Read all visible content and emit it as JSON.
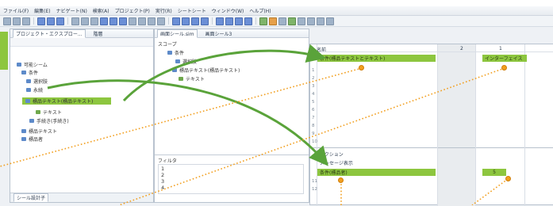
{
  "menubar": {
    "items": [
      "ファイル(F)",
      "編集(E)",
      "ナビゲート(N)",
      "検索(A)",
      "プロジェクト(P)",
      "実行(R)",
      "シートシート",
      "ウィンドウ(W)",
      "ヘルプ(H)"
    ]
  },
  "left_panel": {
    "tabs": [
      "プロジェクト・エクスプロー...",
      "階層"
    ],
    "tree": [
      "可能シーム",
      "条件",
      "選択肢",
      "永続",
      "標品テキスト(標品テキスト)",
      "テキスト",
      "手続き(手続き)",
      "標品テキスト",
      "標品者"
    ],
    "highlighted": "標品テキスト(標品テキスト)",
    "bottom_tab": "シール設計子"
  },
  "middle_panel": {
    "tabs": [
      "画面シール.sim",
      "画面シール3"
    ],
    "scope_label": "スコープ",
    "tree": [
      "条件",
      "選択肢",
      "標品テキスト(標品テキスト)",
      "テキスト"
    ],
    "filter_label": "フィルタ",
    "filter_rows": [
      "1",
      "2",
      "3",
      "4"
    ]
  },
  "right_panel": {
    "header": [
      "名前",
      "2",
      "1"
    ],
    "top_green_left": "条件(標品テキストとテキスト)",
    "top_green_right": "インターフェイス",
    "row_numbers": [
      "1",
      "2",
      "3",
      "4",
      "5",
      "6",
      "7",
      "8",
      "9",
      "10",
      "11",
      "12"
    ],
    "bottom_header": "アクション",
    "bottom_row1": "メッセージ表示",
    "bottom_green_left": "条件(標品者)",
    "bottom_green_right": "5"
  },
  "colors": {
    "highlight_green": "#8dc63f",
    "arrow_green": "#5aa33a",
    "dot_orange": "#f29f1f"
  }
}
